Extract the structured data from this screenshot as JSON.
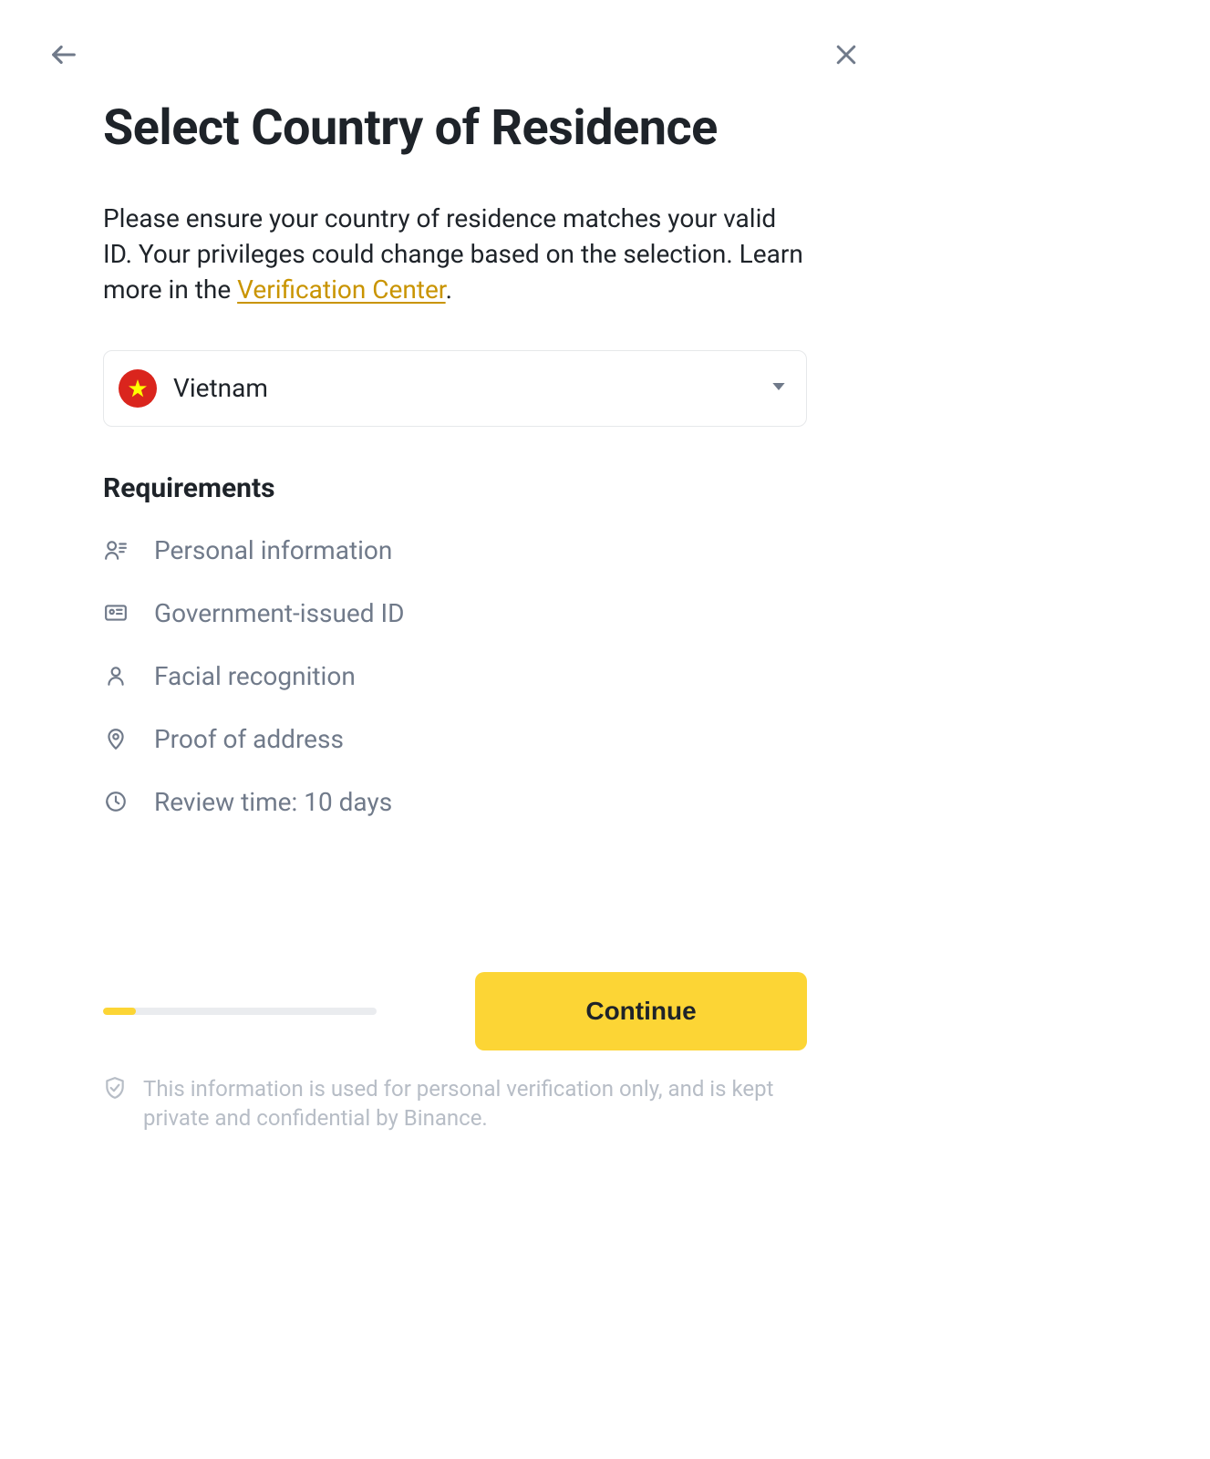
{
  "header": {
    "title": "Select Country of Residence"
  },
  "description": {
    "text_before": "Please ensure your country of residence matches your valid ID. Your privileges could change based on the selection. Learn more in the ",
    "link_text": "Verification Center",
    "text_after": "."
  },
  "country_select": {
    "selected": "Vietnam"
  },
  "requirements": {
    "heading": "Requirements",
    "items": [
      {
        "icon": "person-info-icon",
        "label": "Personal information"
      },
      {
        "icon": "id-card-icon",
        "label": "Government-issued ID"
      },
      {
        "icon": "face-icon",
        "label": "Facial recognition"
      },
      {
        "icon": "location-icon",
        "label": "Proof of address"
      },
      {
        "icon": "clock-icon",
        "label": "Review time: 10 days"
      }
    ]
  },
  "progress": {
    "percent": 12
  },
  "actions": {
    "continue": "Continue"
  },
  "disclaimer": {
    "text": "This information is used for personal verification only, and is kept private and confidential by Binance."
  },
  "colors": {
    "accent": "#fcd535",
    "link": "#c99400",
    "text": "#1e2329",
    "muted": "#707a8a"
  }
}
